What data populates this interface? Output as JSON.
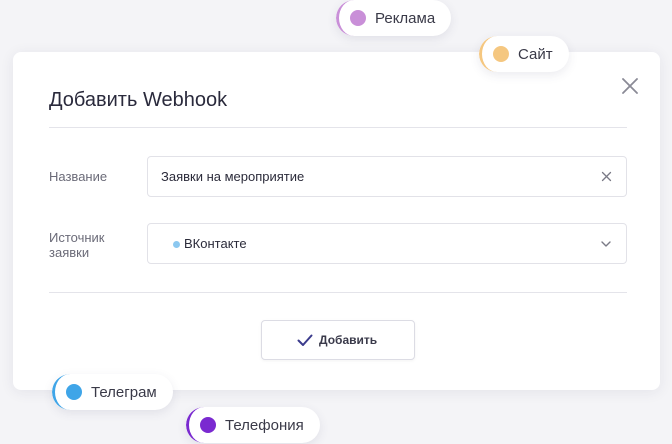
{
  "modal": {
    "title": "Добавить Webhook",
    "name_label": "Название",
    "name_value": "Заявки на мероприятие",
    "source_label_line1": "Источник",
    "source_label_line2": "заявки",
    "source_value": "ВКонтакте",
    "source_dot_color": "#8cc8f0",
    "submit_label": "Добавить",
    "accent_color": "#3b3b8c"
  },
  "chips": [
    {
      "label": "Реклама",
      "color": "#c98fd8"
    },
    {
      "label": "Сайт",
      "color": "#f5c780"
    },
    {
      "label": "Телеграм",
      "color": "#3fa5e8"
    },
    {
      "label": "Телефония",
      "color": "#7a2ad0"
    }
  ]
}
